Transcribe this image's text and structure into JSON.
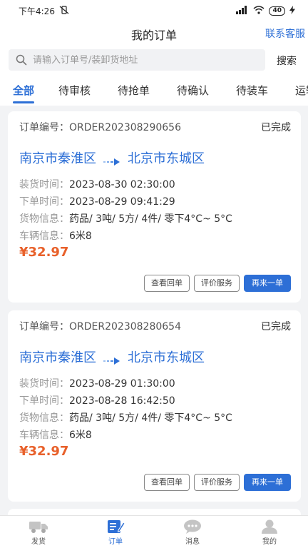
{
  "status_bar": {
    "time": "下午4:26",
    "mute_icon": "vibrate-off-icon",
    "signal": "HD",
    "battery": "40"
  },
  "header": {
    "title": "我的订单",
    "service_link": "联系客服"
  },
  "search": {
    "placeholder": "请输入订单号/装卸货地址",
    "button": "搜索"
  },
  "tabs": [
    {
      "label": "全部",
      "active": true
    },
    {
      "label": "待审核"
    },
    {
      "label": "待抢单"
    },
    {
      "label": "待确认"
    },
    {
      "label": "待装车"
    },
    {
      "label": "运输"
    }
  ],
  "orders": [
    {
      "order_label": "订单编号：",
      "order_no": "ORDER202308290656",
      "status": "已完成",
      "from": "南京市秦淮区",
      "to": "北京市东城区",
      "load_label": "装货时间：",
      "load_time": "2023-08-30 02:30:00",
      "order_time_label": "下单时间：",
      "order_time": "2023-08-29 09:41:29",
      "goods_label": "货物信息：",
      "goods": "药品/ 3吨/ 5方/ 4件/ 零下4°C~ 5°C",
      "vehicle_label": "车辆信息：",
      "vehicle": "6米8",
      "price": "¥32.97",
      "btn_receipt": "查看回单",
      "btn_rate": "评价服务",
      "btn_reorder": "再来一单"
    },
    {
      "order_label": "订单编号：",
      "order_no": "ORDER202308280654",
      "status": "已完成",
      "from": "南京市秦淮区",
      "to": "北京市东城区",
      "load_label": "装货时间：",
      "load_time": "2023-08-29 01:30:00",
      "order_time_label": "下单时间：",
      "order_time": "2023-08-28 16:42:50",
      "goods_label": "货物信息：",
      "goods": "药品/ 3吨/ 5方/ 4件/ 零下4°C~ 5°C",
      "vehicle_label": "车辆信息：",
      "vehicle": "6米8",
      "price": "¥32.97",
      "btn_receipt": "查看回单",
      "btn_rate": "评价服务",
      "btn_reorder": "再来一单"
    }
  ],
  "bottom_nav": [
    {
      "label": "发货",
      "icon": "truck-icon"
    },
    {
      "label": "订单",
      "icon": "order-edit-icon",
      "active": true
    },
    {
      "label": "消息",
      "icon": "chat-icon"
    },
    {
      "label": "我的",
      "icon": "user-icon"
    }
  ],
  "colors": {
    "accent": "#2d6fd6",
    "price": "#e8602a"
  }
}
